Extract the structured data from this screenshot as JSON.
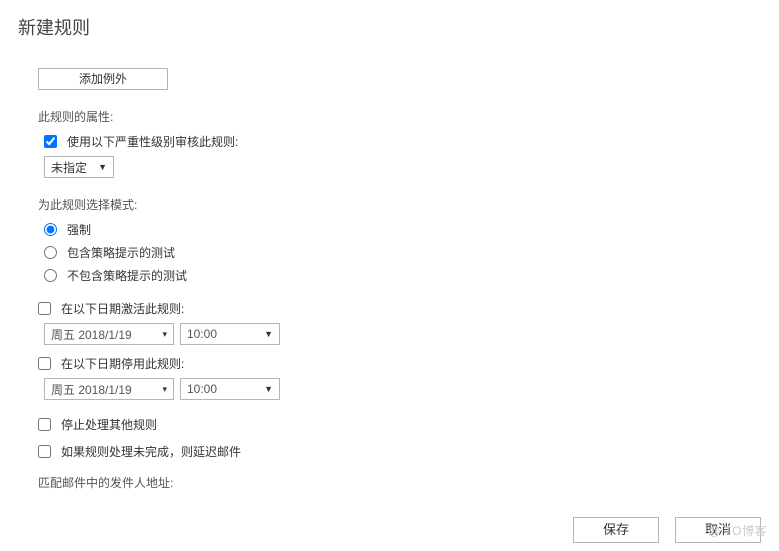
{
  "title": "新建规则",
  "add_exception_btn": "添加例外",
  "properties_label": "此规则的属性:",
  "severity": {
    "checkbox_label": "使用以下严重性级别审核此规则:",
    "checked": true,
    "value": "未指定"
  },
  "mode": {
    "label": "为此规则选择模式:",
    "options": {
      "enforce": "强制",
      "with_tips": "包含策略提示的测试",
      "without_tips": "不包含策略提示的测试"
    },
    "selected": "enforce"
  },
  "activate": {
    "checkbox_label": "在以下日期激活此规则:",
    "checked": false,
    "date": "周五 2018/1/19",
    "time": "10:00"
  },
  "deactivate": {
    "checkbox_label": "在以下日期停用此规则:",
    "checked": false,
    "date": "周五 2018/1/19",
    "time": "10:00"
  },
  "stop_rules": {
    "label": "停止处理其他规则",
    "checked": false
  },
  "defer": {
    "label": "如果规则处理未完成，则延迟邮件",
    "checked": false
  },
  "match_sender_label": "匹配邮件中的发件人地址:",
  "footer": {
    "save": "保存",
    "cancel": "取消"
  },
  "watermark": "@ TO博客"
}
